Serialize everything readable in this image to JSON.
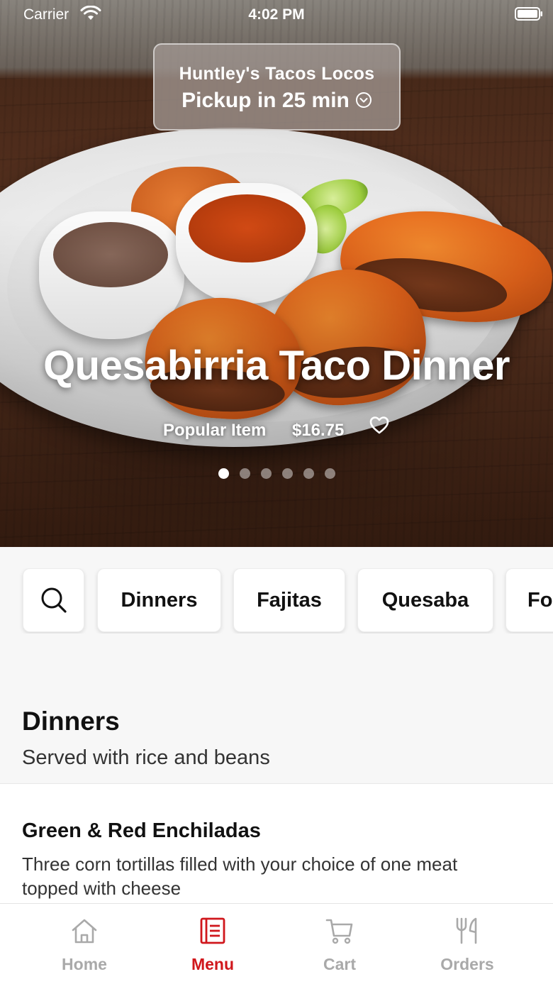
{
  "status_bar": {
    "carrier": "Carrier",
    "time": "4:02 PM"
  },
  "pickup": {
    "restaurant": "Huntley's Tacos Locos",
    "time_label": "Pickup in 25 min"
  },
  "hero": {
    "title": "Quesabirria Taco Dinner",
    "tag": "Popular Item",
    "price": "$16.75",
    "carousel_total": 6,
    "carousel_active": 1
  },
  "categories": {
    "items": [
      "Dinners",
      "Fajitas",
      "Quesaba",
      "Fo"
    ]
  },
  "section": {
    "title": "Dinners",
    "subtitle": "Served with rice and beans"
  },
  "menu_items": [
    {
      "name": "Green & Red Enchiladas",
      "description": "Three corn tortillas filled with your choice of one meat topped with cheese"
    }
  ],
  "tab_bar": {
    "tabs": [
      {
        "label": "Home",
        "icon": "home-icon",
        "active": false
      },
      {
        "label": "Menu",
        "icon": "menu-icon",
        "active": true
      },
      {
        "label": "Cart",
        "icon": "cart-icon",
        "active": false
      },
      {
        "label": "Orders",
        "icon": "fork-knife-icon",
        "active": false
      }
    ]
  },
  "colors": {
    "accent": "#d0171c",
    "inactive_tab": "#a9a9a9",
    "background": "#f7f7f7"
  }
}
